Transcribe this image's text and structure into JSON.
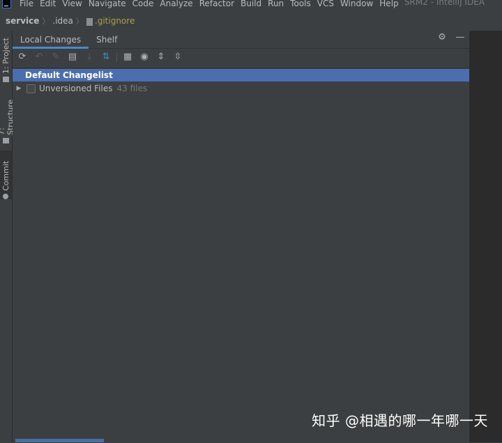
{
  "menubar": {
    "items": [
      "File",
      "Edit",
      "View",
      "Navigate",
      "Code",
      "Analyze",
      "Refactor",
      "Build",
      "Run",
      "Tools",
      "VCS",
      "Window",
      "Help"
    ],
    "window_title": "SRM2 - IntelliJ IDEA"
  },
  "breadcrumb": {
    "items": [
      "service",
      ".idea",
      ".gitignore"
    ]
  },
  "left_strip": {
    "tabs": [
      "1: Project",
      "7: Structure",
      "Commit"
    ]
  },
  "panel": {
    "tabs": [
      "Local Changes",
      "Shelf"
    ],
    "active_tab": "Local Changes",
    "header_icons": [
      "gear-icon",
      "minimize-icon"
    ]
  },
  "toolbar": {
    "buttons": [
      "refresh-icon",
      "rollback-icon",
      "jump-to-source-icon",
      "show-diff-icon",
      "update-icon",
      "shelve-icon",
      "group-by-icon",
      "view-options-icon",
      "expand-all-icon",
      "collapse-all-icon"
    ]
  },
  "tree": {
    "changelist": "Default Changelist",
    "unversioned_label": "Unversioned Files",
    "unversioned_count": "43 files"
  },
  "watermark": "知乎 @相遇的哪一年哪一天"
}
